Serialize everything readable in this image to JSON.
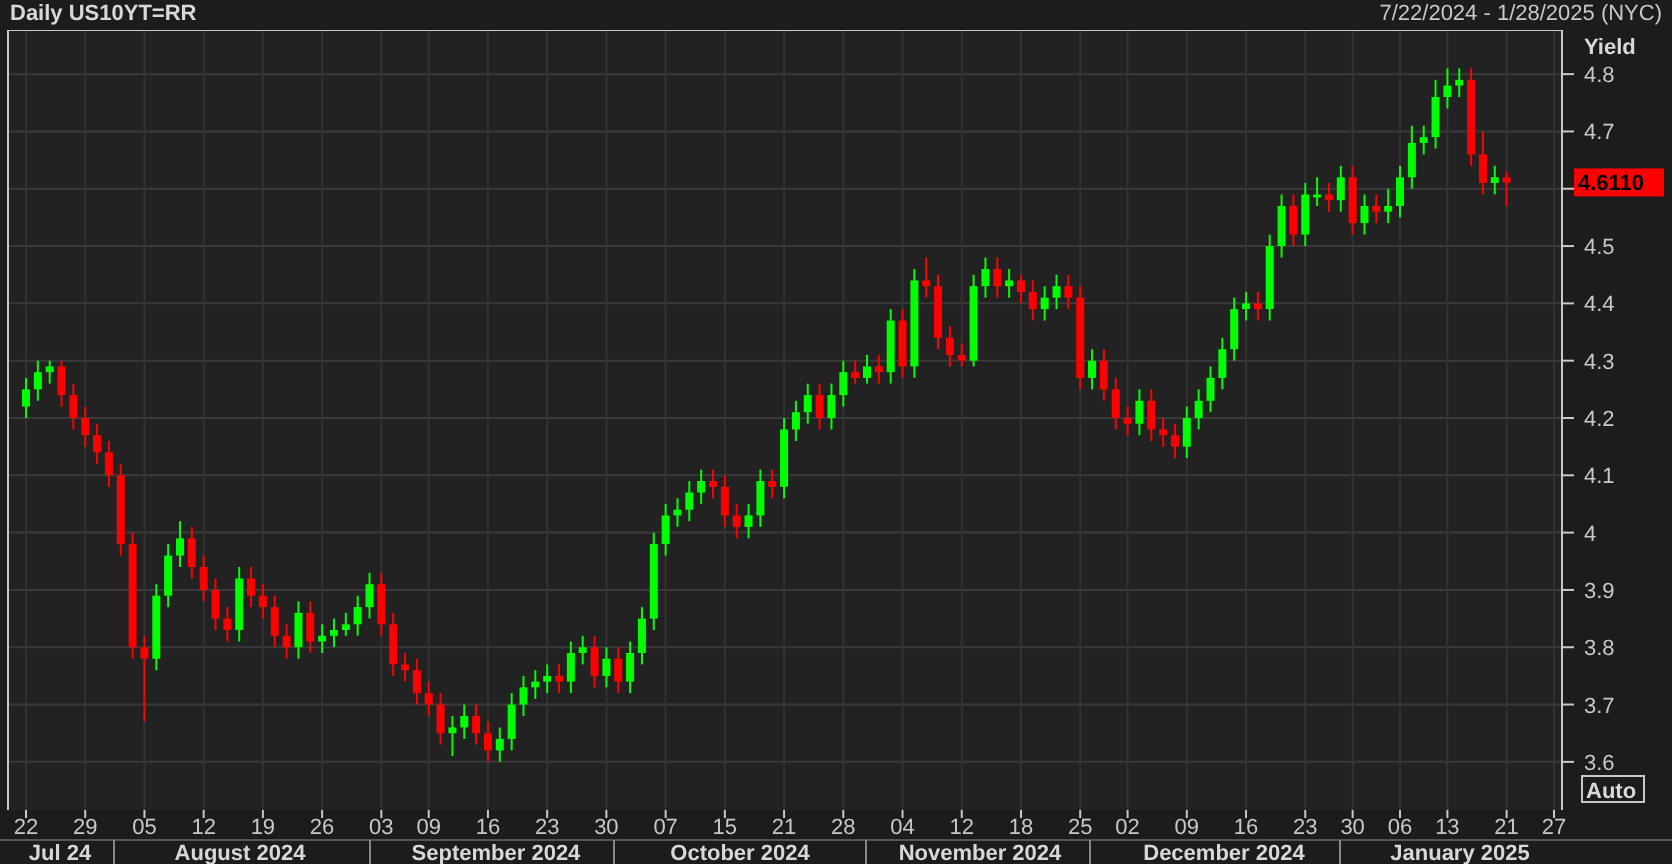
{
  "header": {
    "title": "Daily US10YT=RR",
    "date_range": "7/22/2024 - 1/28/2025 (NYC)"
  },
  "chart_data": {
    "type": "candlestick",
    "ylabel": "Yield",
    "ylim": [
      3.516,
      4.877
    ],
    "grid": true,
    "yticks": [
      4.8,
      4.7,
      4.5,
      4.4,
      4.3,
      4.2,
      4.1,
      4,
      3.9,
      3.8,
      3.7,
      3.6
    ],
    "categories": [
      "22",
      null,
      null,
      null,
      null,
      "29",
      null,
      null,
      null,
      null,
      "05",
      null,
      null,
      null,
      null,
      "12",
      null,
      null,
      null,
      null,
      "19",
      null,
      null,
      null,
      null,
      "26",
      null,
      null,
      null,
      null,
      "03",
      null,
      null,
      null,
      "09",
      null,
      null,
      null,
      null,
      "16",
      null,
      null,
      null,
      null,
      "23",
      null,
      null,
      null,
      null,
      "30",
      null,
      null,
      null,
      null,
      "07",
      null,
      null,
      null,
      null,
      "15",
      null,
      null,
      null,
      null,
      "21",
      null,
      null,
      null,
      null,
      "28",
      null,
      null,
      null,
      null,
      "04",
      null,
      null,
      null,
      null,
      "12",
      null,
      null,
      null,
      null,
      "18",
      null,
      null,
      null,
      null,
      "25",
      null,
      null,
      null,
      "02",
      null,
      null,
      null,
      null,
      "09",
      null,
      null,
      null,
      null,
      "16",
      null,
      null,
      null,
      null,
      "23",
      null,
      null,
      null,
      "30",
      null,
      null,
      null,
      "06",
      null,
      null,
      null,
      "13",
      null,
      null,
      null,
      null,
      "21",
      null,
      null,
      null,
      "27"
    ],
    "ohlc": [
      [
        4.22,
        4.27,
        4.2,
        4.25
      ],
      [
        4.25,
        4.3,
        4.23,
        4.28
      ],
      [
        4.28,
        4.3,
        4.26,
        4.29
      ],
      [
        4.29,
        4.3,
        4.22,
        4.24
      ],
      [
        4.24,
        4.26,
        4.18,
        4.2
      ],
      [
        4.2,
        4.22,
        4.15,
        4.17
      ],
      [
        4.17,
        4.19,
        4.12,
        4.14
      ],
      [
        4.14,
        4.16,
        4.08,
        4.1
      ],
      [
        4.1,
        4.12,
        3.96,
        3.98
      ],
      [
        3.98,
        4.0,
        3.78,
        3.8
      ],
      [
        3.8,
        3.82,
        3.67,
        3.78
      ],
      [
        3.78,
        3.91,
        3.76,
        3.89
      ],
      [
        3.89,
        3.98,
        3.87,
        3.96
      ],
      [
        3.96,
        4.02,
        3.94,
        3.99
      ],
      [
        3.99,
        4.01,
        3.92,
        3.94
      ],
      [
        3.94,
        3.96,
        3.88,
        3.9
      ],
      [
        3.9,
        3.92,
        3.83,
        3.85
      ],
      [
        3.85,
        3.87,
        3.81,
        3.83
      ],
      [
        3.83,
        3.94,
        3.81,
        3.92
      ],
      [
        3.92,
        3.94,
        3.87,
        3.89
      ],
      [
        3.89,
        3.91,
        3.85,
        3.87
      ],
      [
        3.87,
        3.89,
        3.8,
        3.82
      ],
      [
        3.82,
        3.84,
        3.78,
        3.8
      ],
      [
        3.8,
        3.88,
        3.78,
        3.86
      ],
      [
        3.86,
        3.88,
        3.79,
        3.81
      ],
      [
        3.81,
        3.84,
        3.79,
        3.82
      ],
      [
        3.82,
        3.85,
        3.8,
        3.83
      ],
      [
        3.83,
        3.86,
        3.82,
        3.84
      ],
      [
        3.84,
        3.89,
        3.82,
        3.87
      ],
      [
        3.87,
        3.93,
        3.85,
        3.91
      ],
      [
        3.91,
        3.93,
        3.82,
        3.84
      ],
      [
        3.84,
        3.86,
        3.75,
        3.77
      ],
      [
        3.77,
        3.79,
        3.74,
        3.76
      ],
      [
        3.76,
        3.78,
        3.7,
        3.72
      ],
      [
        3.72,
        3.74,
        3.68,
        3.7
      ],
      [
        3.7,
        3.72,
        3.63,
        3.65
      ],
      [
        3.65,
        3.68,
        3.61,
        3.66
      ],
      [
        3.66,
        3.7,
        3.64,
        3.68
      ],
      [
        3.68,
        3.7,
        3.63,
        3.65
      ],
      [
        3.65,
        3.67,
        3.6,
        3.62
      ],
      [
        3.62,
        3.66,
        3.6,
        3.64
      ],
      [
        3.64,
        3.72,
        3.62,
        3.7
      ],
      [
        3.7,
        3.75,
        3.68,
        3.73
      ],
      [
        3.73,
        3.76,
        3.71,
        3.74
      ],
      [
        3.74,
        3.77,
        3.72,
        3.75
      ],
      [
        3.75,
        3.77,
        3.72,
        3.74
      ],
      [
        3.74,
        3.81,
        3.72,
        3.79
      ],
      [
        3.79,
        3.82,
        3.77,
        3.8
      ],
      [
        3.8,
        3.82,
        3.73,
        3.75
      ],
      [
        3.75,
        3.8,
        3.73,
        3.78
      ],
      [
        3.78,
        3.8,
        3.72,
        3.74
      ],
      [
        3.74,
        3.81,
        3.72,
        3.79
      ],
      [
        3.79,
        3.87,
        3.77,
        3.85
      ],
      [
        3.85,
        4.0,
        3.83,
        3.98
      ],
      [
        3.98,
        4.05,
        3.96,
        4.03
      ],
      [
        4.03,
        4.06,
        4.01,
        4.04
      ],
      [
        4.04,
        4.09,
        4.02,
        4.07
      ],
      [
        4.07,
        4.11,
        4.05,
        4.09
      ],
      [
        4.09,
        4.11,
        4.06,
        4.08
      ],
      [
        4.08,
        4.1,
        4.01,
        4.03
      ],
      [
        4.03,
        4.05,
        3.99,
        4.01
      ],
      [
        4.01,
        4.05,
        3.99,
        4.03
      ],
      [
        4.03,
        4.11,
        4.01,
        4.09
      ],
      [
        4.09,
        4.11,
        4.06,
        4.08
      ],
      [
        4.08,
        4.2,
        4.06,
        4.18
      ],
      [
        4.18,
        4.23,
        4.16,
        4.21
      ],
      [
        4.21,
        4.26,
        4.19,
        4.24
      ],
      [
        4.24,
        4.26,
        4.18,
        4.2
      ],
      [
        4.2,
        4.26,
        4.18,
        4.24
      ],
      [
        4.24,
        4.3,
        4.22,
        4.28
      ],
      [
        4.28,
        4.3,
        4.26,
        4.27
      ],
      [
        4.27,
        4.31,
        4.26,
        4.29
      ],
      [
        4.29,
        4.31,
        4.26,
        4.28
      ],
      [
        4.28,
        4.39,
        4.26,
        4.37
      ],
      [
        4.37,
        4.39,
        4.27,
        4.29
      ],
      [
        4.29,
        4.46,
        4.27,
        4.44
      ],
      [
        4.44,
        4.48,
        4.41,
        4.43
      ],
      [
        4.43,
        4.45,
        4.32,
        4.34
      ],
      [
        4.34,
        4.36,
        4.29,
        4.31
      ],
      [
        4.31,
        4.33,
        4.29,
        4.3
      ],
      [
        4.3,
        4.45,
        4.29,
        4.43
      ],
      [
        4.43,
        4.48,
        4.41,
        4.46
      ],
      [
        4.46,
        4.48,
        4.41,
        4.43
      ],
      [
        4.43,
        4.46,
        4.41,
        4.44
      ],
      [
        4.44,
        4.45,
        4.4,
        4.42
      ],
      [
        4.42,
        4.44,
        4.37,
        4.39
      ],
      [
        4.39,
        4.43,
        4.37,
        4.41
      ],
      [
        4.41,
        4.45,
        4.39,
        4.43
      ],
      [
        4.43,
        4.45,
        4.39,
        4.41
      ],
      [
        4.41,
        4.43,
        4.25,
        4.27
      ],
      [
        4.27,
        4.32,
        4.25,
        4.3
      ],
      [
        4.3,
        4.32,
        4.23,
        4.25
      ],
      [
        4.25,
        4.27,
        4.18,
        4.2
      ],
      [
        4.2,
        4.22,
        4.17,
        4.19
      ],
      [
        4.19,
        4.25,
        4.17,
        4.23
      ],
      [
        4.23,
        4.25,
        4.16,
        4.18
      ],
      [
        4.18,
        4.2,
        4.15,
        4.17
      ],
      [
        4.17,
        4.19,
        4.13,
        4.15
      ],
      [
        4.15,
        4.22,
        4.13,
        4.2
      ],
      [
        4.2,
        4.25,
        4.18,
        4.23
      ],
      [
        4.23,
        4.29,
        4.21,
        4.27
      ],
      [
        4.27,
        4.34,
        4.25,
        4.32
      ],
      [
        4.32,
        4.41,
        4.3,
        4.39
      ],
      [
        4.39,
        4.42,
        4.37,
        4.4
      ],
      [
        4.4,
        4.42,
        4.37,
        4.39
      ],
      [
        4.39,
        4.52,
        4.37,
        4.5
      ],
      [
        4.5,
        4.59,
        4.48,
        4.57
      ],
      [
        4.57,
        4.59,
        4.5,
        4.52
      ],
      [
        4.52,
        4.61,
        4.5,
        4.59
      ],
      [
        4.59,
        4.62,
        4.57,
        4.59
      ],
      [
        4.59,
        4.61,
        4.56,
        4.58
      ],
      [
        4.58,
        4.64,
        4.56,
        4.62
      ],
      [
        4.62,
        4.64,
        4.52,
        4.54
      ],
      [
        4.54,
        4.59,
        4.52,
        4.57
      ],
      [
        4.57,
        4.59,
        4.54,
        4.56
      ],
      [
        4.56,
        4.6,
        4.54,
        4.57
      ],
      [
        4.57,
        4.64,
        4.55,
        4.62
      ],
      [
        4.62,
        4.71,
        4.6,
        4.68
      ],
      [
        4.68,
        4.71,
        4.66,
        4.69
      ],
      [
        4.69,
        4.79,
        4.67,
        4.76
      ],
      [
        4.76,
        4.81,
        4.74,
        4.78
      ],
      [
        4.78,
        4.81,
        4.76,
        4.79
      ],
      [
        4.79,
        4.81,
        4.64,
        4.66
      ],
      [
        4.66,
        4.7,
        4.59,
        4.61
      ],
      [
        4.61,
        4.64,
        4.59,
        4.62
      ],
      [
        4.62,
        4.63,
        4.57,
        4.611
      ],
      null,
      null,
      null,
      null
    ]
  },
  "price_tag": {
    "text": "4.6110",
    "color": "#ff0000"
  },
  "auto_button": {
    "label": "Auto"
  },
  "x_axis": {
    "months": [
      "Jul 24",
      "August 2024",
      "September 2024",
      "October 2024",
      "November 2024",
      "December 2024",
      "January 2025"
    ]
  }
}
